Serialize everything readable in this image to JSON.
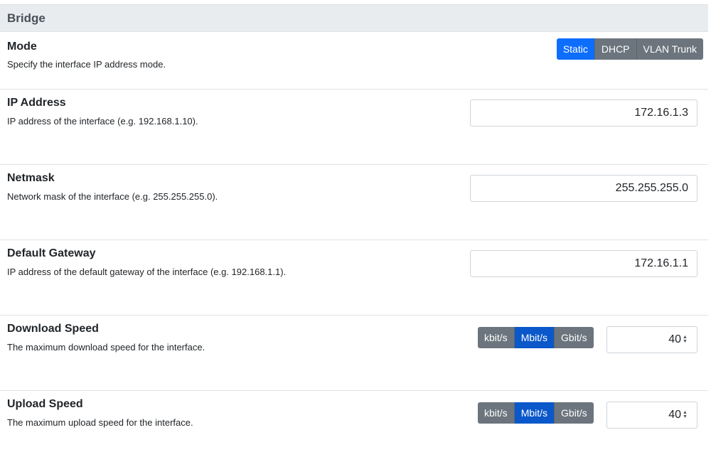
{
  "section": {
    "title": "Bridge"
  },
  "mode": {
    "title": "Mode",
    "description": "Specify the interface IP address mode.",
    "options": [
      "Static",
      "DHCP",
      "VLAN Trunk"
    ],
    "selected": "Static"
  },
  "ip_address": {
    "title": "IP Address",
    "description": "IP address of the interface (e.g. 192.168.1.10).",
    "value": "172.16.1.3"
  },
  "netmask": {
    "title": "Netmask",
    "description": "Network mask of the interface (e.g. 255.255.255.0).",
    "value": "255.255.255.0"
  },
  "gateway": {
    "title": "Default Gateway",
    "description": "IP address of the default gateway of the interface (e.g. 192.168.1.1).",
    "value": "172.16.1.1"
  },
  "download": {
    "title": "Download Speed",
    "description": "The maximum download speed for the interface.",
    "units": [
      "kbit/s",
      "Mbit/s",
      "Gbit/s"
    ],
    "selected_unit": "Mbit/s",
    "value": "40"
  },
  "upload": {
    "title": "Upload Speed",
    "description": "The maximum upload speed for the interface.",
    "units": [
      "kbit/s",
      "Mbit/s",
      "Gbit/s"
    ],
    "selected_unit": "Mbit/s",
    "value": "40"
  },
  "colors": {
    "accent": "#0d6efd",
    "accent_dark": "#0a58ca",
    "secondary": "#6c757d",
    "header_bg": "#e9ecef"
  }
}
